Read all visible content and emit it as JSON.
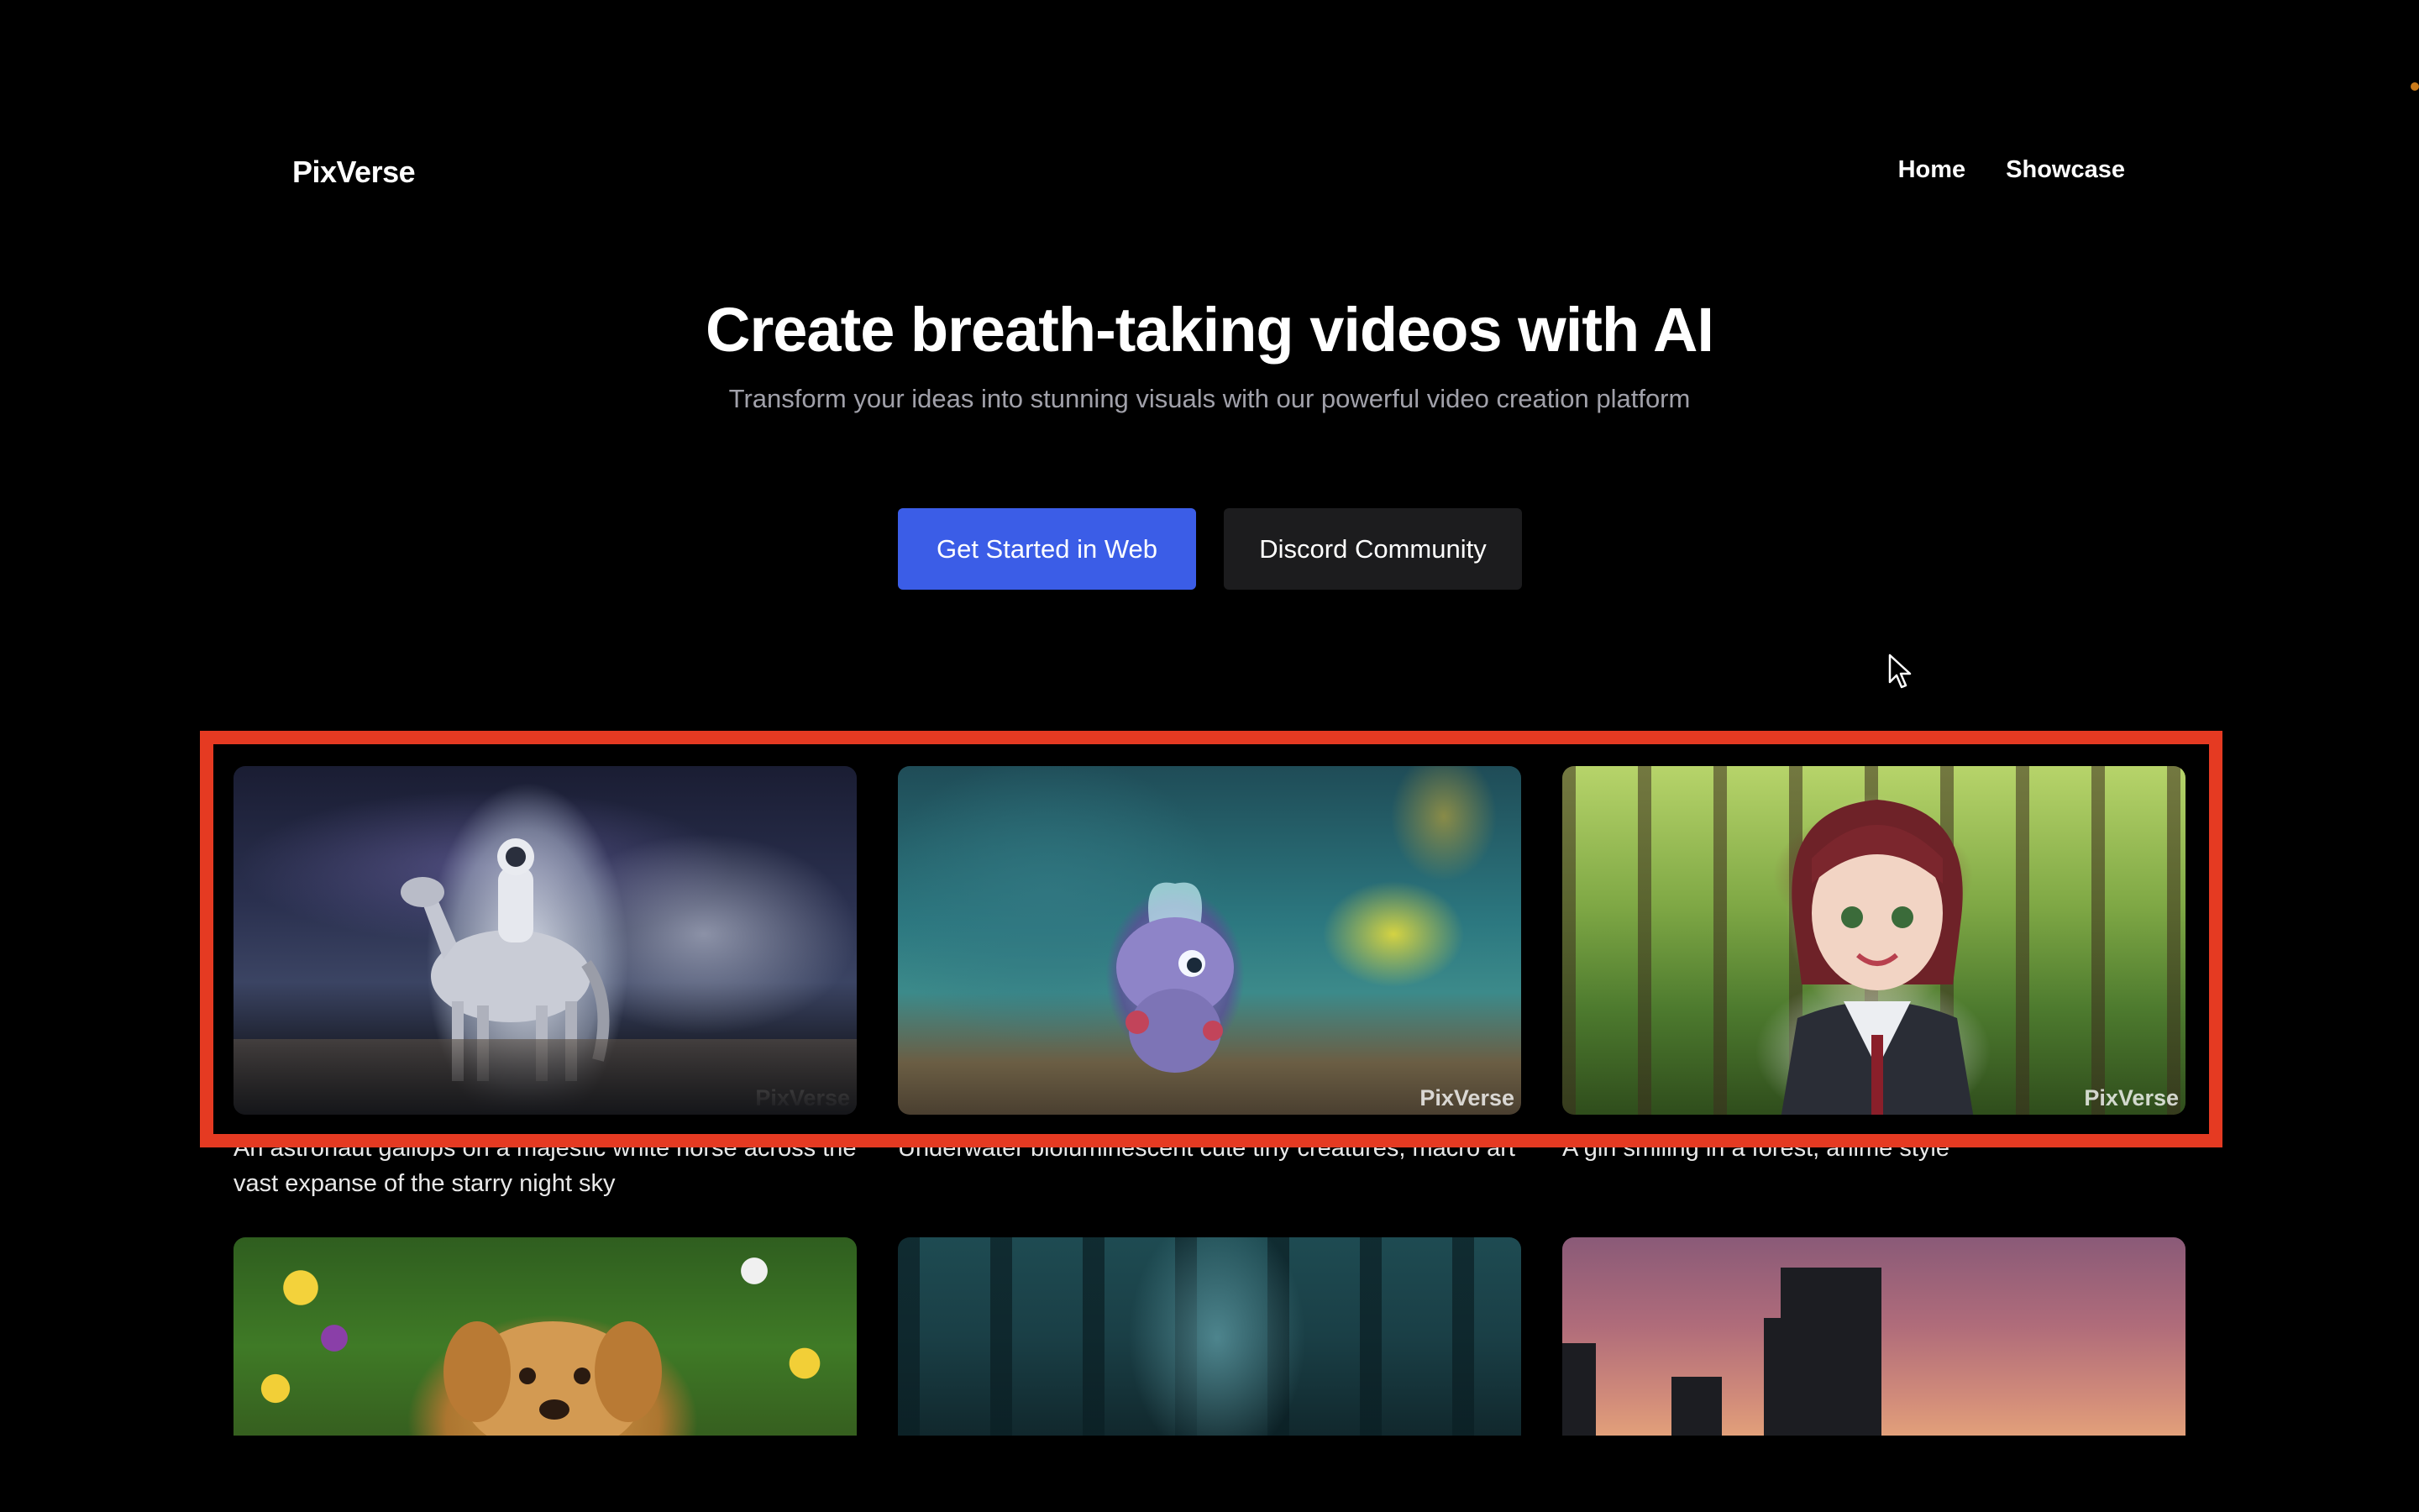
{
  "header": {
    "logo": "PixVerse",
    "nav": [
      {
        "label": "Home"
      },
      {
        "label": "Showcase"
      }
    ]
  },
  "hero": {
    "title": "Create breath-taking videos with AI",
    "subtitle": "Transform your ideas into stunning visuals with our powerful video creation platform",
    "primary_cta": "Get Started in Web",
    "secondary_cta": "Discord Community"
  },
  "gallery": {
    "watermark": "PixVerse",
    "row1": [
      {
        "caption": "An astronaut gallops on a majestic white horse across the vast expanse of the starry night sky"
      },
      {
        "caption": "Underwater bioluminescent cute tiny creatures, macro art"
      },
      {
        "caption": "A girl smiling in a forest, anime style"
      }
    ]
  },
  "colors": {
    "background": "#000000",
    "primary_button": "#3b5de7",
    "secondary_button": "#1c1c1e",
    "highlight": "#e53a22",
    "subtitle": "#a1a1aa"
  },
  "icons": {
    "cursor": "mouse-pointer-icon"
  }
}
